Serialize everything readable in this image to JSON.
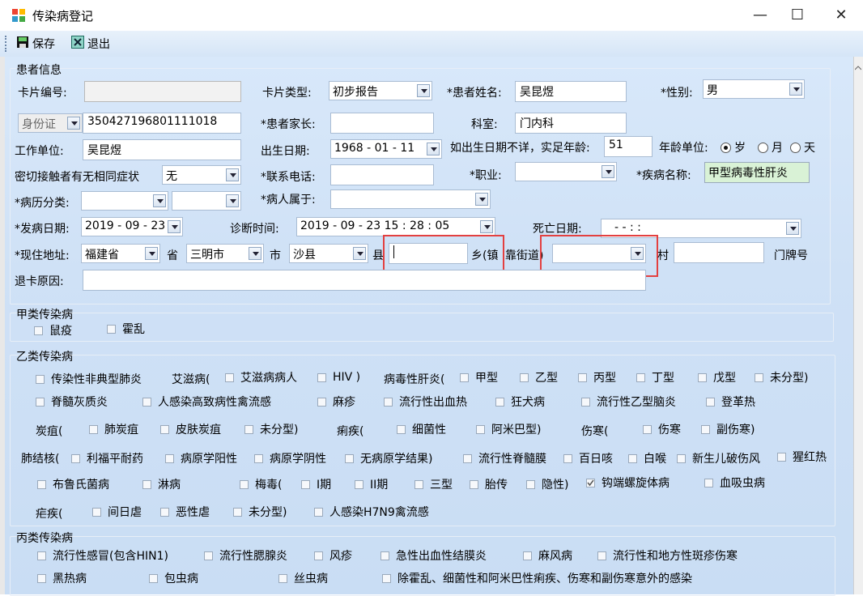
{
  "window": {
    "title": "传染病登记",
    "min": "—",
    "max": "☐",
    "close": "✕"
  },
  "toolbar": {
    "save": "保存",
    "exit": "退出"
  },
  "patient": {
    "group_title": "患者信息",
    "card_no_label": "卡片编号:",
    "card_type_label": "卡片类型:",
    "card_type_value": "初步报告",
    "name_label": "*患者姓名:",
    "name_value": "吴昆煜",
    "sex_label": "*性别:",
    "sex_value": "男",
    "id_type": "身份证",
    "id_value": "350427196801111018",
    "parent_label": "*患者家长:",
    "dept_label": "科室:",
    "dept_value": "门内科",
    "work_label": "工作单位:",
    "work_value": "吴昆煜",
    "birth_label": "出生日期:",
    "birth_value": "1968 - 01 - 11",
    "age_label": "如出生日期不详，实足年龄:",
    "age_value": "51",
    "age_unit_label": "年龄单位:",
    "age_units": [
      "岁",
      "月",
      "天"
    ],
    "contact_label": "密切接触者有无相同症状",
    "contact_value": "无",
    "phone_label": "*联系电话:",
    "job_label": "*职业:",
    "disease_label": "*疾病名称:",
    "disease_value": "甲型病毒性肝炎",
    "case_class_label": "*病历分类:",
    "belong_label": "*病人属于:",
    "onset_label": "*发病日期:",
    "onset_value": "2019 - 09 - 23",
    "diag_label": "诊断时间:",
    "diag_value": "2019 - 09 - 23    15 : 28 : 05",
    "death_label": "死亡日期:",
    "death_value": "-    -           :     :",
    "addr_label": "*现住地址:",
    "province_value": "福建省",
    "province_unit": "省",
    "city_value": "三明市",
    "city_unit": "市",
    "county_value": "沙县",
    "county_unit": "县",
    "town_unit": "乡(镇",
    "street_unit": "靠街道)",
    "village_unit": "村",
    "door_unit": "门牌号",
    "return_label": "退卡原因:"
  },
  "class_a": {
    "title": "甲类传染病",
    "items": [
      "鼠疫",
      "霍乱"
    ]
  },
  "class_b": {
    "title": "乙类传染病",
    "r1": {
      "sars": "传染性非典型肺炎",
      "aids": "艾滋病(",
      "aids_patient": "艾滋病病人",
      "hiv": "HIV )",
      "hep": "病毒性肝炎(",
      "hep_a": "甲型",
      "hep_b": "乙型",
      "hep_c": "丙型",
      "hep_d": "丁型",
      "hep_e": "戊型",
      "hep_u": "未分型)"
    },
    "r2": {
      "polio": "脊髓灰质炎",
      "h5n1": "人感染高致病性禽流感",
      "measles": "麻疹",
      "ehf": "流行性出血热",
      "rabies": "狂犬病",
      "jbe": "流行性乙型脑炎",
      "dengue": "登革热"
    },
    "r3": {
      "anthrax": "炭疽(",
      "lung": "肺炭疽",
      "skin": "皮肤炭疽",
      "unk": "未分型)",
      "dys": "痢疾(",
      "bac": "细菌性",
      "amoeba": "阿米巴型)",
      "typhoid": "伤寒(",
      "typhoid2": "伤寒",
      "para": "副伤寒)"
    },
    "r4": {
      "tb": "肺结核(",
      "rif": "利福平耐药",
      "pos": "病原学阳性",
      "neg": "病原学阴性",
      "none": "无病原学结果)",
      "mening": "流行性脊髓膜",
      "pertussis": "百日咳",
      "diph": "白喉",
      "tetanus": "新生儿破伤风",
      "scarlet": "猩红热"
    },
    "r5": {
      "brucella": "布鲁氏菌病",
      "gon": "淋病",
      "syph": "梅毒(",
      "s1": "I期",
      "s2": "II期",
      "s3": "三型",
      "fetal": "胎传",
      "latent": "隐性)",
      "lepto": "钩端螺旋体病",
      "schisto": "血吸虫病"
    },
    "r6": {
      "malaria": "疟疾(",
      "vivax": "间日虐",
      "falc": "恶性虐",
      "unk": "未分型)",
      "h7n9": "人感染H7N9禽流感"
    }
  },
  "class_c": {
    "title": "丙类传染病",
    "r1": {
      "flu": "流行性感冒(包含HIN1)",
      "mumps": "流行性腮腺炎",
      "rubella": "风疹",
      "conj": "急性出血性结膜炎",
      "leprosy": "麻风病",
      "typhus": "流行性和地方性斑疹伤寒"
    },
    "r2": {
      "kala": "黑热病",
      "echino": "包虫病",
      "filar": "丝虫病",
      "other": "除霍乱、细菌性和阿米巴性痢疾、伤寒和副伤寒意外的感染"
    }
  }
}
